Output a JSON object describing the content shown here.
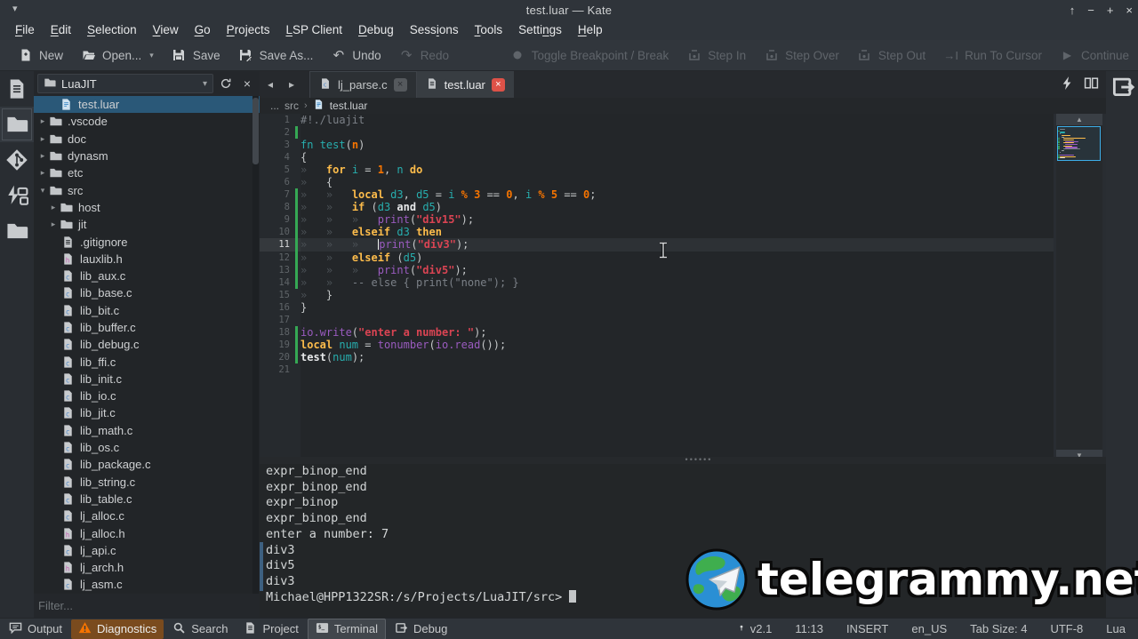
{
  "colors": {
    "accent": "#3daee9",
    "selection": "#2a5878",
    "modified_bar": "#35a854",
    "warning": "#f67400",
    "active_tab_close": "#dd5248",
    "keyword": "#fdbc4b",
    "variable": "#27aeae",
    "number": "#f67400",
    "function": "#9a5bbf",
    "string": "#da4453",
    "comment": "#7b8087"
  },
  "window": {
    "title": "test.luar  —  Kate",
    "controls": [
      "keep-above",
      "minimize",
      "maximize",
      "close"
    ]
  },
  "menubar": {
    "items": [
      {
        "label": "File",
        "accel": 0
      },
      {
        "label": "Edit",
        "accel": 0
      },
      {
        "label": "Selection",
        "accel": 0
      },
      {
        "label": "View",
        "accel": 0
      },
      {
        "label": "Go",
        "accel": 0
      },
      {
        "label": "Projects",
        "accel": 0
      },
      {
        "label": "LSP Client",
        "accel": 0
      },
      {
        "label": "Debug",
        "accel": 0
      },
      {
        "label": "Sessions",
        "accel": 4
      },
      {
        "label": "Tools",
        "accel": 0
      },
      {
        "label": "Settings",
        "accel": 5
      },
      {
        "label": "Help",
        "accel": 0
      }
    ]
  },
  "toolbar": {
    "buttons": [
      {
        "label": "New",
        "icon": "new-file-icon",
        "enabled": true
      },
      {
        "label": "Open...",
        "icon": "folder-open-icon",
        "enabled": true,
        "dropdown": true
      },
      {
        "label": "Save",
        "icon": "save-icon",
        "enabled": true
      },
      {
        "label": "Save As...",
        "icon": "save-as-icon",
        "enabled": true
      },
      {
        "label": "Undo",
        "icon": "undo-icon",
        "enabled": true
      },
      {
        "label": "Redo",
        "icon": "redo-icon",
        "enabled": false
      },
      {
        "label": "Toggle Breakpoint / Break",
        "icon": "breakpoint-icon",
        "enabled": false,
        "gap_before": true
      },
      {
        "label": "Step In",
        "icon": "step-in-icon",
        "enabled": false
      },
      {
        "label": "Step Over",
        "icon": "step-over-icon",
        "enabled": false
      },
      {
        "label": "Step Out",
        "icon": "step-out-icon",
        "enabled": false
      },
      {
        "label": "Run To Cursor",
        "icon": "run-to-cursor-icon",
        "enabled": false
      },
      {
        "label": "Continue",
        "icon": "continue-icon",
        "enabled": false
      }
    ]
  },
  "left_strip": {
    "icons": [
      {
        "name": "documents-icon",
        "selected": false
      },
      {
        "name": "filesystem-icon",
        "selected": true
      },
      {
        "name": "git-icon",
        "selected": false
      },
      {
        "name": "lsp-symbols-icon",
        "selected": false
      },
      {
        "name": "projects-folder-icon",
        "selected": false
      }
    ]
  },
  "project_panel": {
    "selector_label": "LuaJIT",
    "header_buttons": [
      "refresh",
      "close"
    ],
    "filter_placeholder": "Filter...",
    "tree": [
      {
        "label": "test.luar",
        "icon": "file-lua",
        "pad": 28,
        "selected": true
      },
      {
        "label": ".vscode",
        "icon": "folder",
        "pad": 4,
        "arrow": "right"
      },
      {
        "label": "doc",
        "icon": "folder",
        "pad": 4,
        "arrow": "right"
      },
      {
        "label": "dynasm",
        "icon": "folder",
        "pad": 4,
        "arrow": "right"
      },
      {
        "label": "etc",
        "icon": "folder",
        "pad": 4,
        "arrow": "right"
      },
      {
        "label": "src",
        "icon": "folder",
        "pad": 4,
        "arrow": "down"
      },
      {
        "label": "host",
        "icon": "folder",
        "pad": 16,
        "arrow": "right"
      },
      {
        "label": "jit",
        "icon": "folder",
        "pad": 16,
        "arrow": "right"
      },
      {
        "label": ".gitignore",
        "icon": "file-text",
        "pad": 30
      },
      {
        "label": "lauxlib.h",
        "icon": "file-h",
        "pad": 30
      },
      {
        "label": "lib_aux.c",
        "icon": "file-c",
        "pad": 30
      },
      {
        "label": "lib_base.c",
        "icon": "file-c",
        "pad": 30
      },
      {
        "label": "lib_bit.c",
        "icon": "file-c",
        "pad": 30
      },
      {
        "label": "lib_buffer.c",
        "icon": "file-c",
        "pad": 30
      },
      {
        "label": "lib_debug.c",
        "icon": "file-c",
        "pad": 30
      },
      {
        "label": "lib_ffi.c",
        "icon": "file-c",
        "pad": 30
      },
      {
        "label": "lib_init.c",
        "icon": "file-c",
        "pad": 30
      },
      {
        "label": "lib_io.c",
        "icon": "file-c",
        "pad": 30
      },
      {
        "label": "lib_jit.c",
        "icon": "file-c",
        "pad": 30
      },
      {
        "label": "lib_math.c",
        "icon": "file-c",
        "pad": 30
      },
      {
        "label": "lib_os.c",
        "icon": "file-c",
        "pad": 30
      },
      {
        "label": "lib_package.c",
        "icon": "file-c",
        "pad": 30
      },
      {
        "label": "lib_string.c",
        "icon": "file-c",
        "pad": 30
      },
      {
        "label": "lib_table.c",
        "icon": "file-c",
        "pad": 30
      },
      {
        "label": "lj_alloc.c",
        "icon": "file-c",
        "pad": 30
      },
      {
        "label": "lj_alloc.h",
        "icon": "file-h",
        "pad": 30
      },
      {
        "label": "lj_api.c",
        "icon": "file-c",
        "pad": 30
      },
      {
        "label": "lj_arch.h",
        "icon": "file-h",
        "pad": 30
      },
      {
        "label": "lj_asm.c",
        "icon": "file-c",
        "pad": 30
      }
    ]
  },
  "tabbar": {
    "tabs": [
      {
        "label": "lj_parse.c",
        "icon": "file-c",
        "active": false
      },
      {
        "label": "test.luar",
        "icon": "file-text",
        "active": true
      }
    ],
    "right_icons": [
      "lightning-icon",
      "split-view-icon"
    ],
    "breadcrumb": {
      "ellipsis": "...",
      "folder": "src",
      "file": "test.luar"
    }
  },
  "editor": {
    "current_line": 11,
    "caret_line": 11,
    "lines": [
      {
        "n": 1,
        "ind": 0,
        "chg": false,
        "tk": [
          [
            "#!./luajit",
            "cm"
          ]
        ]
      },
      {
        "n": 2,
        "ind": 0,
        "chg": true,
        "tk": []
      },
      {
        "n": 3,
        "ind": 0,
        "chg": false,
        "tk": [
          [
            "fn ",
            "var"
          ],
          [
            "test",
            "var"
          ],
          [
            "(",
            "txt"
          ],
          [
            "n",
            "num"
          ],
          [
            ")",
            "txt"
          ]
        ]
      },
      {
        "n": 4,
        "ind": 0,
        "chg": false,
        "tk": [
          [
            "{",
            "txt"
          ]
        ]
      },
      {
        "n": 5,
        "ind": 1,
        "chg": false,
        "tk": [
          [
            "for ",
            "kw"
          ],
          [
            "i ",
            "var"
          ],
          [
            "= ",
            "op"
          ],
          [
            "1",
            "num"
          ],
          [
            ", ",
            "txt"
          ],
          [
            "n ",
            "var"
          ],
          [
            "do",
            "kw"
          ]
        ]
      },
      {
        "n": 6,
        "ind": 1,
        "chg": false,
        "tk": [
          [
            "{",
            "txt"
          ]
        ]
      },
      {
        "n": 7,
        "ind": 2,
        "chg": true,
        "tk": [
          [
            "local ",
            "kw"
          ],
          [
            "d3",
            "var"
          ],
          [
            ", ",
            "txt"
          ],
          [
            "d5 ",
            "var"
          ],
          [
            "= ",
            "op"
          ],
          [
            "i ",
            "var"
          ],
          [
            "% ",
            "num"
          ],
          [
            "3 ",
            "num"
          ],
          [
            "== ",
            "op"
          ],
          [
            "0",
            "num"
          ],
          [
            ", ",
            "txt"
          ],
          [
            "i ",
            "var"
          ],
          [
            "% ",
            "num"
          ],
          [
            "5 ",
            "num"
          ],
          [
            "== ",
            "op"
          ],
          [
            "0",
            "num"
          ],
          [
            ";",
            "txt"
          ]
        ]
      },
      {
        "n": 8,
        "ind": 2,
        "chg": true,
        "tk": [
          [
            "if ",
            "kw"
          ],
          [
            "(",
            "txt"
          ],
          [
            "d3 ",
            "var"
          ],
          [
            "and ",
            "bw"
          ],
          [
            "d5",
            "var"
          ],
          [
            ")",
            "txt"
          ]
        ]
      },
      {
        "n": 9,
        "ind": 3,
        "chg": true,
        "tk": [
          [
            "print",
            "fn"
          ],
          [
            "(",
            "txt"
          ],
          [
            "\"div15\"",
            "str"
          ],
          [
            ");",
            "txt"
          ]
        ]
      },
      {
        "n": 10,
        "ind": 2,
        "chg": true,
        "tk": [
          [
            "elseif ",
            "kw"
          ],
          [
            "d3 ",
            "var"
          ],
          [
            "then",
            "kw"
          ]
        ]
      },
      {
        "n": 11,
        "ind": 3,
        "chg": true,
        "tk": [
          [
            "print",
            "fn"
          ],
          [
            "(",
            "txt"
          ],
          [
            "\"div3\"",
            "str"
          ],
          [
            ");",
            "txt"
          ]
        ]
      },
      {
        "n": 12,
        "ind": 2,
        "chg": true,
        "tk": [
          [
            "elseif ",
            "kw"
          ],
          [
            "(",
            "txt"
          ],
          [
            "d5",
            "var"
          ],
          [
            ")",
            "txt"
          ]
        ]
      },
      {
        "n": 13,
        "ind": 3,
        "chg": true,
        "tk": [
          [
            "print",
            "fn"
          ],
          [
            "(",
            "txt"
          ],
          [
            "\"div5\"",
            "str"
          ],
          [
            ");",
            "txt"
          ]
        ]
      },
      {
        "n": 14,
        "ind": 2,
        "chg": true,
        "tk": [
          [
            "-- else { print(\"none\"); }",
            "cm"
          ]
        ]
      },
      {
        "n": 15,
        "ind": 1,
        "chg": false,
        "tk": [
          [
            "}",
            "txt"
          ]
        ]
      },
      {
        "n": 16,
        "ind": 0,
        "chg": false,
        "tk": [
          [
            "}",
            "txt"
          ]
        ]
      },
      {
        "n": 17,
        "ind": 0,
        "chg": false,
        "tk": []
      },
      {
        "n": 18,
        "ind": 0,
        "chg": true,
        "tk": [
          [
            "io.write",
            "fn"
          ],
          [
            "(",
            "txt"
          ],
          [
            "\"enter a number: \"",
            "str"
          ],
          [
            ");",
            "txt"
          ]
        ]
      },
      {
        "n": 19,
        "ind": 0,
        "chg": true,
        "tk": [
          [
            "local ",
            "kw"
          ],
          [
            "num ",
            "var"
          ],
          [
            "= ",
            "op"
          ],
          [
            "tonumber",
            "fn"
          ],
          [
            "(",
            "txt"
          ],
          [
            "io.read",
            "fn"
          ],
          [
            "());",
            "txt"
          ]
        ]
      },
      {
        "n": 20,
        "ind": 0,
        "chg": true,
        "tk": [
          [
            "test",
            "bw"
          ],
          [
            "(",
            "txt"
          ],
          [
            "num",
            "var"
          ],
          [
            ");",
            "txt"
          ]
        ]
      },
      {
        "n": 21,
        "ind": 0,
        "chg": false,
        "tk": []
      }
    ]
  },
  "terminal": {
    "lines": [
      "expr_binop_end",
      "expr_binop_end",
      "expr_binop",
      "expr_binop_end",
      "enter a number: 7",
      "div3",
      "div5",
      "div3"
    ],
    "prompt": "Michael@HPP1322SR:/s/Projects/LuaJIT/src>"
  },
  "statusbar": {
    "left": [
      {
        "label": "Output",
        "icon": "output-icon"
      },
      {
        "label": "Diagnostics",
        "icon": "warning-icon",
        "active": true
      },
      {
        "label": "Search",
        "icon": "search-icon"
      },
      {
        "label": "Project",
        "icon": "project-icon"
      },
      {
        "label": "Terminal",
        "icon": "terminal-icon",
        "toggled": true
      },
      {
        "label": "Debug",
        "icon": "debug-icon"
      }
    ],
    "right": [
      {
        "label": "v2.1",
        "icon": "branch-dot-icon"
      },
      {
        "label": "11:13"
      },
      {
        "label": "INSERT"
      },
      {
        "label": "en_US"
      },
      {
        "label": "Tab Size: 4"
      },
      {
        "label": "UTF-8"
      },
      {
        "label": "Lua"
      }
    ]
  },
  "watermark": {
    "text": "telegrammy.net"
  }
}
